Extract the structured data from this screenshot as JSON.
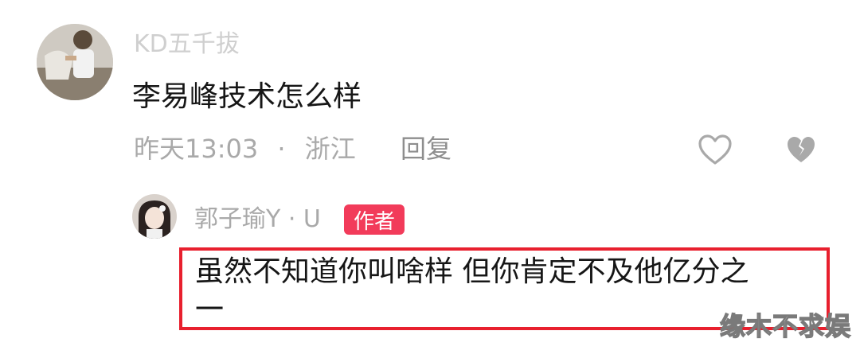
{
  "comment": {
    "username": "KD五千拔",
    "text": "李易峰技术怎么样",
    "time": "昨天13:03",
    "dot": "·",
    "location": "浙江",
    "reply_label": "回复"
  },
  "reply": {
    "username": "郭子瑜Y · U",
    "badge": "作者",
    "text_line1": "虽然不知道你叫啥样 但你肯定不及他亿分之",
    "text_line2": "一"
  },
  "watermark": "缘木不求娱",
  "colors": {
    "highlight_box": "#e8202e",
    "author_badge": "#f23b5a",
    "muted_text": "#a9a9a9"
  },
  "icons": {
    "like": "heart-icon",
    "dislike": "broken-heart-icon"
  }
}
